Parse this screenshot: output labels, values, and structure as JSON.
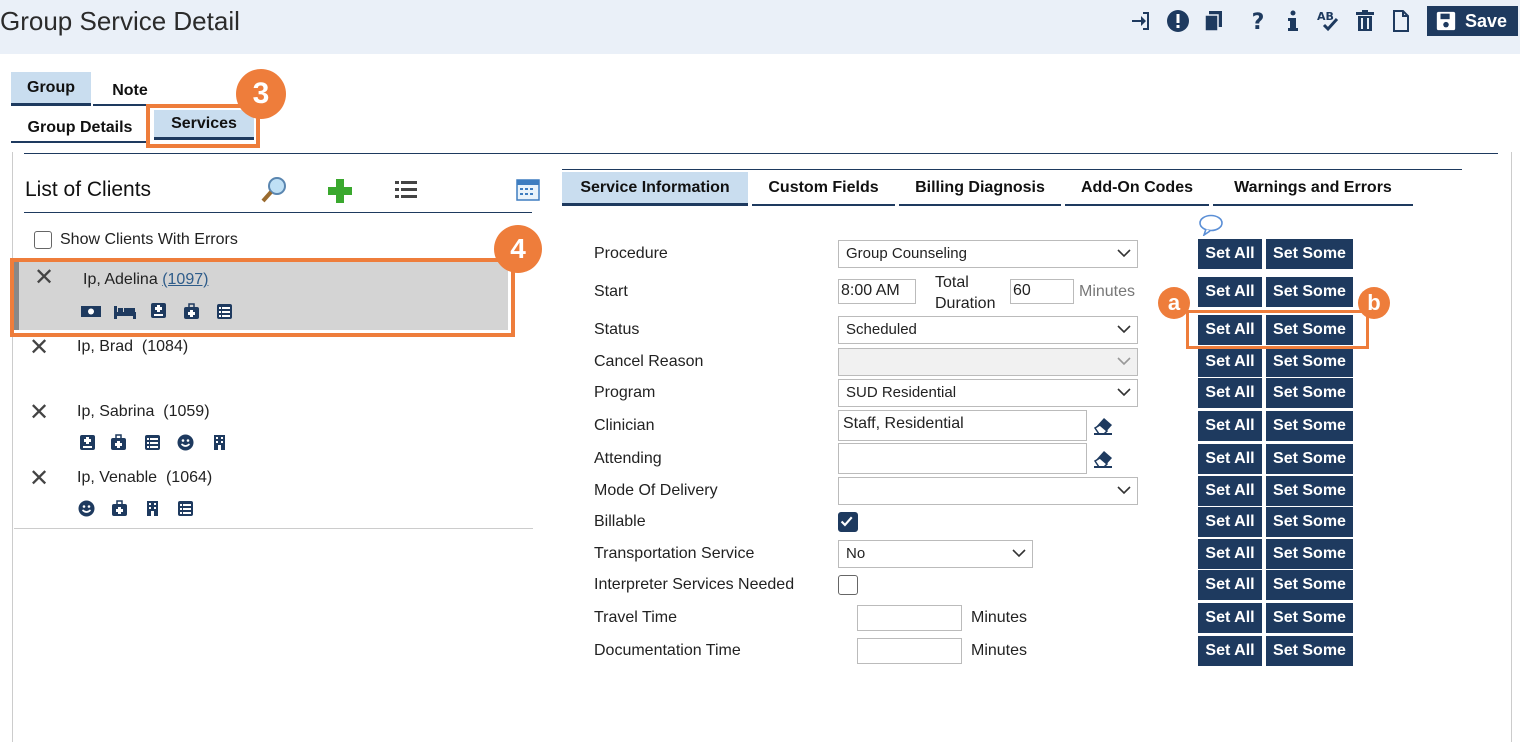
{
  "header": {
    "title": "Group Service Detail",
    "save_label": "Save",
    "toolbar_icons": [
      "sign-in-icon",
      "alert-icon",
      "copy-icon",
      "help-icon",
      "info-icon",
      "spellcheck-icon",
      "delete-icon",
      "document-icon",
      "save-icon"
    ]
  },
  "top_tabs": {
    "row1": [
      "Group",
      "Note"
    ],
    "row2": [
      "Group Details",
      "Services"
    ],
    "active_row1": "Group",
    "active_row2": "Services"
  },
  "callouts": {
    "c3": "3",
    "c4": "4",
    "ca": "a",
    "cb": "b"
  },
  "client_list": {
    "title": "List of Clients",
    "show_errors_label": "Show Clients With Errors",
    "show_errors_checked": false,
    "clients": [
      {
        "name": "Ip, Adelina",
        "id": "(1097)",
        "selected": true,
        "icons": [
          "money-icon",
          "bed-icon",
          "medical-note-icon",
          "medical-bag-icon",
          "list-icon"
        ]
      },
      {
        "name": "Ip, Brad",
        "id": "(1084)",
        "selected": false,
        "icons": []
      },
      {
        "name": "Ip, Sabrina",
        "id": "(1059)",
        "selected": false,
        "icons": [
          "medical-note-icon",
          "medical-bag-icon",
          "list-icon",
          "smiley-icon",
          "building-icon"
        ]
      },
      {
        "name": "Ip, Venable",
        "id": "(1064)",
        "selected": false,
        "icons": [
          "smiley-icon",
          "medical-bag-icon",
          "building-icon",
          "list-icon"
        ]
      }
    ]
  },
  "service_tabs": [
    "Service Information",
    "Custom Fields",
    "Billing Diagnosis",
    "Add-On Codes",
    "Warnings and Errors"
  ],
  "form": {
    "procedure": {
      "label": "Procedure",
      "value": "Group Counseling"
    },
    "start": {
      "label": "Start",
      "value": "8:00 AM",
      "total_duration_label": "Total\nDuration",
      "duration_value": "60",
      "minutes_label": "Minutes"
    },
    "status": {
      "label": "Status",
      "value": "Scheduled"
    },
    "cancel_reason": {
      "label": "Cancel Reason",
      "value": ""
    },
    "program": {
      "label": "Program",
      "value": "SUD Residential"
    },
    "clinician": {
      "label": "Clinician",
      "value": "Staff, Residential"
    },
    "attending": {
      "label": "Attending",
      "value": ""
    },
    "mode_of_delivery": {
      "label": "Mode Of Delivery",
      "value": ""
    },
    "billable": {
      "label": "Billable",
      "checked": true
    },
    "transportation": {
      "label": "Transportation Service",
      "value": "No"
    },
    "interpreter": {
      "label": "Interpreter Services Needed",
      "checked": false
    },
    "travel_time": {
      "label": "Travel Time",
      "value": "",
      "unit": "Minutes"
    },
    "documentation_time": {
      "label": "Documentation Time",
      "value": "",
      "unit": "Minutes"
    }
  },
  "buttons": {
    "set_all": "Set All",
    "set_some": "Set Some"
  }
}
